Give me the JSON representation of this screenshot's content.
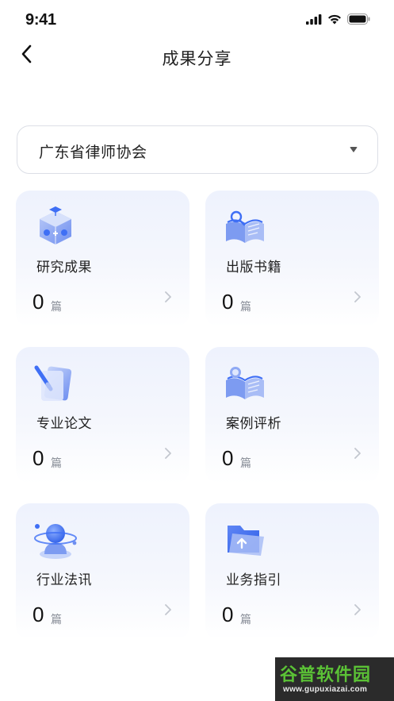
{
  "status_bar": {
    "time": "9:41",
    "icons": [
      "signal-icon",
      "wifi-icon",
      "battery-icon"
    ]
  },
  "nav": {
    "title": "成果分享",
    "back_icon": "chevron-left-icon"
  },
  "org_select": {
    "value": "广东省律师协会",
    "caret_icon": "caret-down-icon"
  },
  "cards": [
    {
      "title": "研究成果",
      "count": "0",
      "unit": "篇",
      "icon": "research-cube-icon"
    },
    {
      "title": "出版书籍",
      "count": "0",
      "unit": "篇",
      "icon": "open-book-icon"
    },
    {
      "title": "专业论文",
      "count": "0",
      "unit": "篇",
      "icon": "paper-pen-icon"
    },
    {
      "title": "案例评析",
      "count": "0",
      "unit": "篇",
      "icon": "case-book-icon"
    },
    {
      "title": "行业法讯",
      "count": "0",
      "unit": "篇",
      "icon": "news-globe-icon"
    },
    {
      "title": "业务指引",
      "count": "0",
      "unit": "篇",
      "icon": "guide-folder-icon"
    }
  ],
  "watermark": {
    "main": "谷普软件园",
    "url": "www.gupuxiazai.com"
  },
  "colors": {
    "accent_blue": "#3f6ff5",
    "card_bg": "#eef2fd",
    "border": "#dcdfe6",
    "watermark_green": "#5bc236"
  }
}
